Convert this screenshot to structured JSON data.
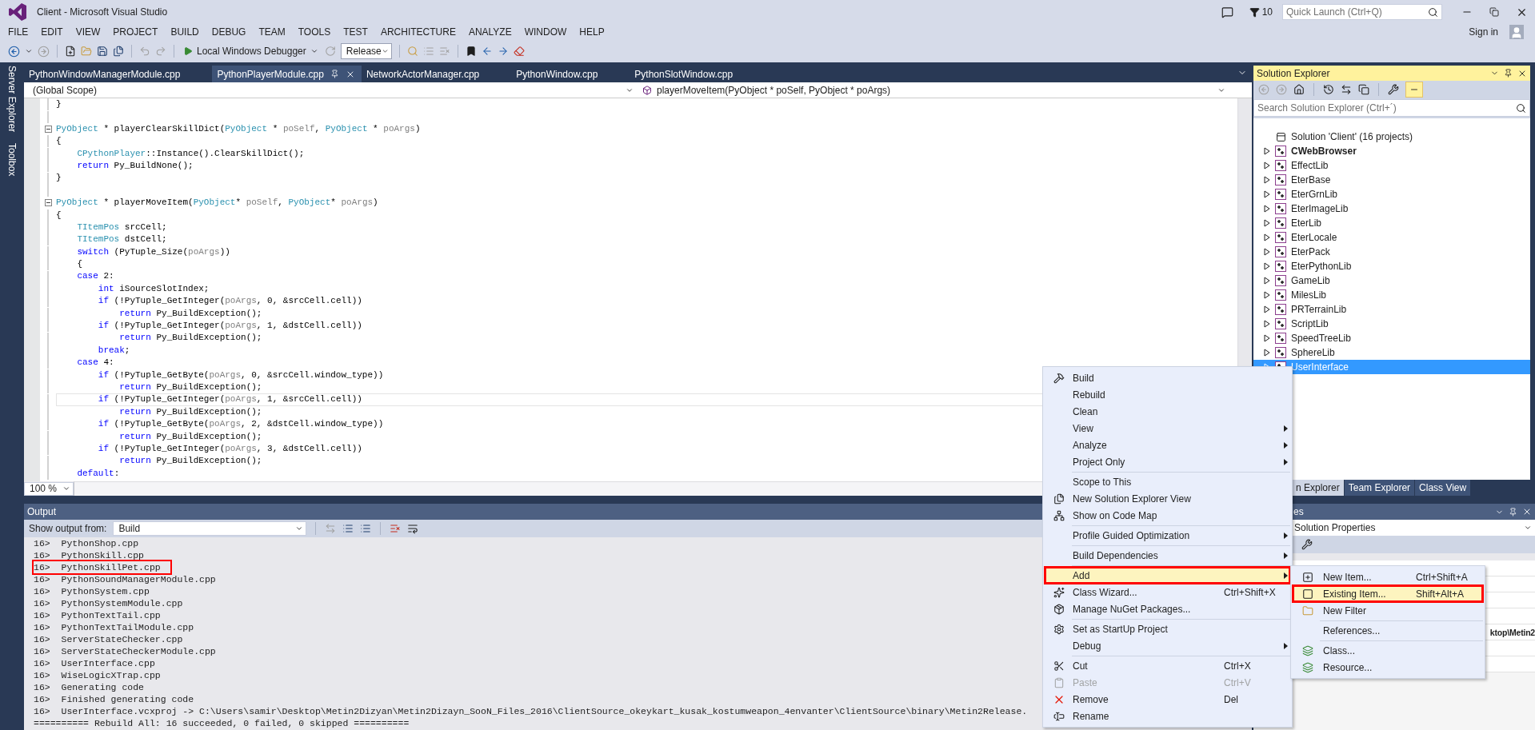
{
  "window": {
    "title": "Client - Microsoft Visual Studio"
  },
  "notifications": {
    "count": "10"
  },
  "quick_launch": {
    "placeholder": "Quick Launch (Ctrl+Q)"
  },
  "account": {
    "label": "Sign in"
  },
  "menu_bar": [
    "FILE",
    "EDIT",
    "VIEW",
    "PROJECT",
    "BUILD",
    "DEBUG",
    "TEAM",
    "TOOLS",
    "TEST",
    "ARCHITECTURE",
    "ANALYZE",
    "WINDOW",
    "HELP"
  ],
  "toolbar": {
    "debugger": "Local Windows Debugger",
    "configuration": "Release"
  },
  "side_tabs": [
    "Server Explorer",
    "Toolbox"
  ],
  "editor_tabs": [
    {
      "label": "PythonWindowManagerModule.cpp",
      "selected": false
    },
    {
      "label": "PythonPlayerModule.cpp",
      "selected": true
    },
    {
      "label": "NetworkActorManager.cpp",
      "selected": false
    },
    {
      "label": "PythonWindow.cpp",
      "selected": false
    },
    {
      "label": "PythonSlotWindow.cpp",
      "selected": false
    }
  ],
  "scope": {
    "global": "(Global Scope)",
    "member": "playerMoveItem(PyObject * poSelf, PyObject * poArgs)"
  },
  "code_lines": [
    {
      "kind": "code",
      "fold": false,
      "current": false,
      "tokens": [
        {
          "t": "}",
          "kind": "plain"
        }
      ]
    },
    {
      "kind": "blank",
      "fold": false,
      "current": false
    },
    {
      "kind": "code",
      "fold": true,
      "current": false,
      "tokens": [
        {
          "t": "PyObject",
          "kind": "type"
        },
        {
          "t": " * playerClearSkillDict(",
          "kind": "plain"
        },
        {
          "t": "PyObject",
          "kind": "type"
        },
        {
          "t": " * ",
          "kind": "plain"
        },
        {
          "t": "poSelf",
          "kind": "param"
        },
        {
          "t": ", ",
          "kind": "plain"
        },
        {
          "t": "PyObject",
          "kind": "type"
        },
        {
          "t": " * ",
          "kind": "plain"
        },
        {
          "t": "poArgs",
          "kind": "param"
        },
        {
          "t": ")",
          "kind": "plain"
        }
      ]
    },
    {
      "kind": "code",
      "fold": false,
      "current": false,
      "tokens": [
        {
          "t": "{",
          "kind": "plain"
        }
      ]
    },
    {
      "kind": "code",
      "fold": false,
      "current": false,
      "tokens": [
        {
          "t": "    CPythonPlayer",
          "kind": "type"
        },
        {
          "t": "::Instance().ClearSkillDict();",
          "kind": "plain"
        }
      ]
    },
    {
      "kind": "code",
      "fold": false,
      "current": false,
      "tokens": [
        {
          "t": "    return",
          "kind": "keyword"
        },
        {
          "t": " Py_BuildNone();",
          "kind": "plain"
        }
      ]
    },
    {
      "kind": "code",
      "fold": false,
      "current": false,
      "tokens": [
        {
          "t": "}",
          "kind": "plain"
        }
      ]
    },
    {
      "kind": "blank",
      "fold": false,
      "current": false
    },
    {
      "kind": "code",
      "fold": true,
      "current": false,
      "tokens": [
        {
          "t": "PyObject",
          "kind": "type"
        },
        {
          "t": " * playerMoveItem(",
          "kind": "plain"
        },
        {
          "t": "PyObject",
          "kind": "type"
        },
        {
          "t": "* ",
          "kind": "plain"
        },
        {
          "t": "poSelf",
          "kind": "param"
        },
        {
          "t": ", ",
          "kind": "plain"
        },
        {
          "t": "PyObject",
          "kind": "type"
        },
        {
          "t": "* ",
          "kind": "plain"
        },
        {
          "t": "poArgs",
          "kind": "param"
        },
        {
          "t": ")",
          "kind": "plain"
        }
      ]
    },
    {
      "kind": "code",
      "fold": false,
      "current": false,
      "tokens": [
        {
          "t": "{",
          "kind": "plain"
        }
      ]
    },
    {
      "kind": "code",
      "fold": false,
      "current": false,
      "tokens": [
        {
          "t": "    TItemPos",
          "kind": "type"
        },
        {
          "t": " srcCell;",
          "kind": "plain"
        }
      ]
    },
    {
      "kind": "code",
      "fold": false,
      "current": false,
      "tokens": [
        {
          "t": "    TItemPos",
          "kind": "type"
        },
        {
          "t": " dstCell;",
          "kind": "plain"
        }
      ]
    },
    {
      "kind": "code",
      "fold": false,
      "current": false,
      "tokens": [
        {
          "t": "    switch",
          "kind": "keyword"
        },
        {
          "t": " (PyTuple_Size(",
          "kind": "plain"
        },
        {
          "t": "poArgs",
          "kind": "param"
        },
        {
          "t": "))",
          "kind": "plain"
        }
      ]
    },
    {
      "kind": "code",
      "fold": false,
      "current": false,
      "tokens": [
        {
          "t": "    {",
          "kind": "plain"
        }
      ]
    },
    {
      "kind": "code",
      "fold": false,
      "current": false,
      "tokens": [
        {
          "t": "    case",
          "kind": "keyword"
        },
        {
          "t": " 2:",
          "kind": "plain"
        }
      ]
    },
    {
      "kind": "code",
      "fold": false,
      "current": false,
      "tokens": [
        {
          "t": "        int",
          "kind": "keyword"
        },
        {
          "t": " iSourceSlotIndex;",
          "kind": "plain"
        }
      ]
    },
    {
      "kind": "code",
      "fold": false,
      "current": false,
      "tokens": [
        {
          "t": "        if",
          "kind": "keyword"
        },
        {
          "t": " (!PyTuple_GetInteger(",
          "kind": "plain"
        },
        {
          "t": "poArgs",
          "kind": "param"
        },
        {
          "t": ", 0, &srcCell.cell))",
          "kind": "plain"
        }
      ]
    },
    {
      "kind": "code",
      "fold": false,
      "current": false,
      "tokens": [
        {
          "t": "            return",
          "kind": "keyword"
        },
        {
          "t": " Py_BuildException();",
          "kind": "plain"
        }
      ]
    },
    {
      "kind": "code",
      "fold": false,
      "current": false,
      "tokens": [
        {
          "t": "        if",
          "kind": "keyword"
        },
        {
          "t": " (!PyTuple_GetInteger(",
          "kind": "plain"
        },
        {
          "t": "poArgs",
          "kind": "param"
        },
        {
          "t": ", 1, &dstCell.cell))",
          "kind": "plain"
        }
      ]
    },
    {
      "kind": "code",
      "fold": false,
      "current": false,
      "tokens": [
        {
          "t": "            return",
          "kind": "keyword"
        },
        {
          "t": " Py_BuildException();",
          "kind": "plain"
        }
      ]
    },
    {
      "kind": "code",
      "fold": false,
      "current": false,
      "tokens": [
        {
          "t": "        break",
          "kind": "keyword"
        },
        {
          "t": ";",
          "kind": "plain"
        }
      ]
    },
    {
      "kind": "code",
      "fold": false,
      "current": false,
      "tokens": [
        {
          "t": "    case",
          "kind": "keyword"
        },
        {
          "t": " 4:",
          "kind": "plain"
        }
      ]
    },
    {
      "kind": "code",
      "fold": false,
      "current": false,
      "tokens": [
        {
          "t": "        if",
          "kind": "keyword"
        },
        {
          "t": " (!PyTuple_GetByte(",
          "kind": "plain"
        },
        {
          "t": "poArgs",
          "kind": "param"
        },
        {
          "t": ", 0, &srcCell.window_type))",
          "kind": "plain"
        }
      ]
    },
    {
      "kind": "code",
      "fold": false,
      "current": false,
      "tokens": [
        {
          "t": "            return",
          "kind": "keyword"
        },
        {
          "t": " Py_BuildException();",
          "kind": "plain"
        }
      ]
    },
    {
      "kind": "code",
      "fold": false,
      "current": true,
      "tokens": [
        {
          "t": "        if",
          "kind": "keyword"
        },
        {
          "t": " (!PyTuple_GetInteger(",
          "kind": "plain"
        },
        {
          "t": "poArgs",
          "kind": "param"
        },
        {
          "t": ", 1, &srcCell.cell))",
          "kind": "plain"
        }
      ]
    },
    {
      "kind": "code",
      "fold": false,
      "current": false,
      "tokens": [
        {
          "t": "            return",
          "kind": "keyword"
        },
        {
          "t": " Py_BuildException();",
          "kind": "plain"
        }
      ]
    },
    {
      "kind": "code",
      "fold": false,
      "current": false,
      "tokens": [
        {
          "t": "        if",
          "kind": "keyword"
        },
        {
          "t": " (!PyTuple_GetByte(",
          "kind": "plain"
        },
        {
          "t": "poArgs",
          "kind": "param"
        },
        {
          "t": ", 2, &dstCell.window_type))",
          "kind": "plain"
        }
      ]
    },
    {
      "kind": "code",
      "fold": false,
      "current": false,
      "tokens": [
        {
          "t": "            return",
          "kind": "keyword"
        },
        {
          "t": " Py_BuildException();",
          "kind": "plain"
        }
      ]
    },
    {
      "kind": "code",
      "fold": false,
      "current": false,
      "tokens": [
        {
          "t": "        if",
          "kind": "keyword"
        },
        {
          "t": " (!PyTuple_GetInteger(",
          "kind": "plain"
        },
        {
          "t": "poArgs",
          "kind": "param"
        },
        {
          "t": ", 3, &dstCell.cell))",
          "kind": "plain"
        }
      ]
    },
    {
      "kind": "code",
      "fold": false,
      "current": false,
      "tokens": [
        {
          "t": "            return",
          "kind": "keyword"
        },
        {
          "t": " Py_BuildException();",
          "kind": "plain"
        }
      ]
    },
    {
      "kind": "code",
      "fold": false,
      "current": false,
      "tokens": [
        {
          "t": "    default",
          "kind": "keyword"
        },
        {
          "t": ":",
          "kind": "plain"
        }
      ]
    }
  ],
  "zoom": "100 %",
  "output": {
    "title": "Output",
    "source_label": "Show output from:",
    "source": "Build",
    "lines": [
      {
        "text": "16>  PythonShop.cpp",
        "annotated": false
      },
      {
        "text": "16>  PythonSkill.cpp",
        "annotated": false
      },
      {
        "text": "16>  PythonSkillPet.cpp",
        "annotated": true
      },
      {
        "text": "16>  PythonSoundManagerModule.cpp",
        "annotated": false
      },
      {
        "text": "16>  PythonSystem.cpp",
        "annotated": false
      },
      {
        "text": "16>  PythonSystemModule.cpp",
        "annotated": false
      },
      {
        "text": "16>  PythonTextTail.cpp",
        "annotated": false
      },
      {
        "text": "16>  PythonTextTailModule.cpp",
        "annotated": false
      },
      {
        "text": "16>  ServerStateChecker.cpp",
        "annotated": false
      },
      {
        "text": "16>  ServerStateCheckerModule.cpp",
        "annotated": false
      },
      {
        "text": "16>  UserInterface.cpp",
        "annotated": false
      },
      {
        "text": "16>  WiseLogicXTrap.cpp",
        "annotated": false
      },
      {
        "text": "16>  Generating code",
        "annotated": false
      },
      {
        "text": "16>  Finished generating code",
        "annotated": false
      },
      {
        "text": "16>  UserInterface.vcxproj -> C:\\Users\\samir\\Desktop\\Metin2Dizyan\\Metin2Dizayn_SooN_Files_2016\\ClientSource_okeykart_kusak_kostumweapon_4envanter\\ClientSource\\binary\\Metin2Release.",
        "annotated": false
      },
      {
        "text": "========== Rebuild All: 16 succeeded, 0 failed, 0 skipped ==========",
        "annotated": false
      }
    ]
  },
  "solution_explorer": {
    "title": "Solution Explorer",
    "search_placeholder": "Search Solution Explorer (Ctrl+´)",
    "solution": "Solution 'Client' (16 projects)",
    "projects": [
      {
        "name": "CWebBrowser",
        "startup": true,
        "selected": false
      },
      {
        "name": "EffectLib",
        "startup": false,
        "selected": false
      },
      {
        "name": "EterBase",
        "startup": false,
        "selected": false
      },
      {
        "name": "EterGrnLib",
        "startup": false,
        "selected": false
      },
      {
        "name": "EterImageLib",
        "startup": false,
        "selected": false
      },
      {
        "name": "EterLib",
        "startup": false,
        "selected": false
      },
      {
        "name": "EterLocale",
        "startup": false,
        "selected": false
      },
      {
        "name": "EterPack",
        "startup": false,
        "selected": false
      },
      {
        "name": "EterPythonLib",
        "startup": false,
        "selected": false
      },
      {
        "name": "GameLib",
        "startup": false,
        "selected": false
      },
      {
        "name": "MilesLib",
        "startup": false,
        "selected": false
      },
      {
        "name": "PRTerrainLib",
        "startup": false,
        "selected": false
      },
      {
        "name": "ScriptLib",
        "startup": false,
        "selected": false
      },
      {
        "name": "SpeedTreeLib",
        "startup": false,
        "selected": false
      },
      {
        "name": "SphereLib",
        "startup": false,
        "selected": false
      },
      {
        "name": "UserInterface",
        "startup": false,
        "selected": true
      }
    ],
    "tabs": [
      {
        "label": "n Explorer",
        "selected": true
      },
      {
        "label": "Team Explorer",
        "selected": false
      },
      {
        "label": "Class View",
        "selected": false
      }
    ]
  },
  "properties": {
    "title": "es",
    "object": "Solution Properties",
    "value": "ktop\\Metin2"
  },
  "context_menu": {
    "items": [
      {
        "kind": "item",
        "label": "Build",
        "arrow": false,
        "selected": false,
        "disabled": false,
        "annotated": false
      },
      {
        "kind": "item",
        "label": "Rebuild",
        "arrow": false,
        "selected": false,
        "disabled": false,
        "annotated": false
      },
      {
        "kind": "item",
        "label": "Clean",
        "arrow": false,
        "selected": false,
        "disabled": false,
        "annotated": false
      },
      {
        "kind": "item",
        "label": "View",
        "arrow": true,
        "selected": false,
        "disabled": false,
        "annotated": false
      },
      {
        "kind": "item",
        "label": "Analyze",
        "arrow": true,
        "selected": false,
        "disabled": false,
        "annotated": false
      },
      {
        "kind": "item",
        "label": "Project Only",
        "arrow": true,
        "selected": false,
        "disabled": false,
        "annotated": false
      },
      {
        "kind": "separator"
      },
      {
        "kind": "item",
        "label": "Scope to This",
        "arrow": false,
        "selected": false,
        "disabled": false,
        "annotated": false
      },
      {
        "kind": "item",
        "label": "New Solution Explorer View",
        "arrow": false,
        "selected": false,
        "disabled": false,
        "annotated": false
      },
      {
        "kind": "item",
        "label": "Show on Code Map",
        "arrow": false,
        "selected": false,
        "disabled": false,
        "annotated": false
      },
      {
        "kind": "separator"
      },
      {
        "kind": "item",
        "label": "Profile Guided Optimization",
        "arrow": true,
        "selected": false,
        "disabled": false,
        "annotated": false
      },
      {
        "kind": "separator"
      },
      {
        "kind": "item",
        "label": "Build Dependencies",
        "arrow": true,
        "selected": false,
        "disabled": false,
        "annotated": false
      },
      {
        "kind": "separator"
      },
      {
        "kind": "item",
        "label": "Add",
        "arrow": true,
        "selected": true,
        "disabled": false,
        "annotated": true
      },
      {
        "kind": "item",
        "label": "Class Wizard...",
        "shortcut": "Ctrl+Shift+X",
        "arrow": false,
        "selected": false,
        "disabled": false,
        "annotated": false
      },
      {
        "kind": "item",
        "label": "Manage NuGet Packages...",
        "arrow": false,
        "selected": false,
        "disabled": false,
        "annotated": false
      },
      {
        "kind": "separator"
      },
      {
        "kind": "item",
        "label": "Set as StartUp Project",
        "arrow": false,
        "selected": false,
        "disabled": false,
        "annotated": false
      },
      {
        "kind": "item",
        "label": "Debug",
        "arrow": true,
        "selected": false,
        "disabled": false,
        "annotated": false
      },
      {
        "kind": "separator"
      },
      {
        "kind": "item",
        "label": "Cut",
        "shortcut": "Ctrl+X",
        "arrow": false,
        "selected": false,
        "disabled": false,
        "annotated": false
      },
      {
        "kind": "item",
        "label": "Paste",
        "shortcut": "Ctrl+V",
        "arrow": false,
        "selected": false,
        "disabled": true,
        "annotated": false
      },
      {
        "kind": "item",
        "label": "Remove",
        "shortcut": "Del",
        "arrow": false,
        "selected": false,
        "disabled": false,
        "annotated": false
      },
      {
        "kind": "item",
        "label": "Rename",
        "arrow": false,
        "selected": false,
        "disabled": false,
        "annotated": false
      }
    ],
    "submenu": [
      {
        "kind": "item",
        "label": "New Item...",
        "shortcut": "Ctrl+Shift+A",
        "selected": false,
        "annotated": false
      },
      {
        "kind": "item",
        "label": "Existing Item...",
        "shortcut": "Shift+Alt+A",
        "selected": true,
        "annotated": true
      },
      {
        "kind": "item",
        "label": "New Filter",
        "selected": false,
        "annotated": false
      },
      {
        "kind": "separator"
      },
      {
        "kind": "item",
        "label": "References...",
        "selected": false,
        "annotated": false
      },
      {
        "kind": "separator"
      },
      {
        "kind": "item",
        "label": "Class...",
        "selected": false,
        "annotated": false
      },
      {
        "kind": "item",
        "label": "Resource...",
        "selected": false,
        "annotated": false
      }
    ]
  }
}
